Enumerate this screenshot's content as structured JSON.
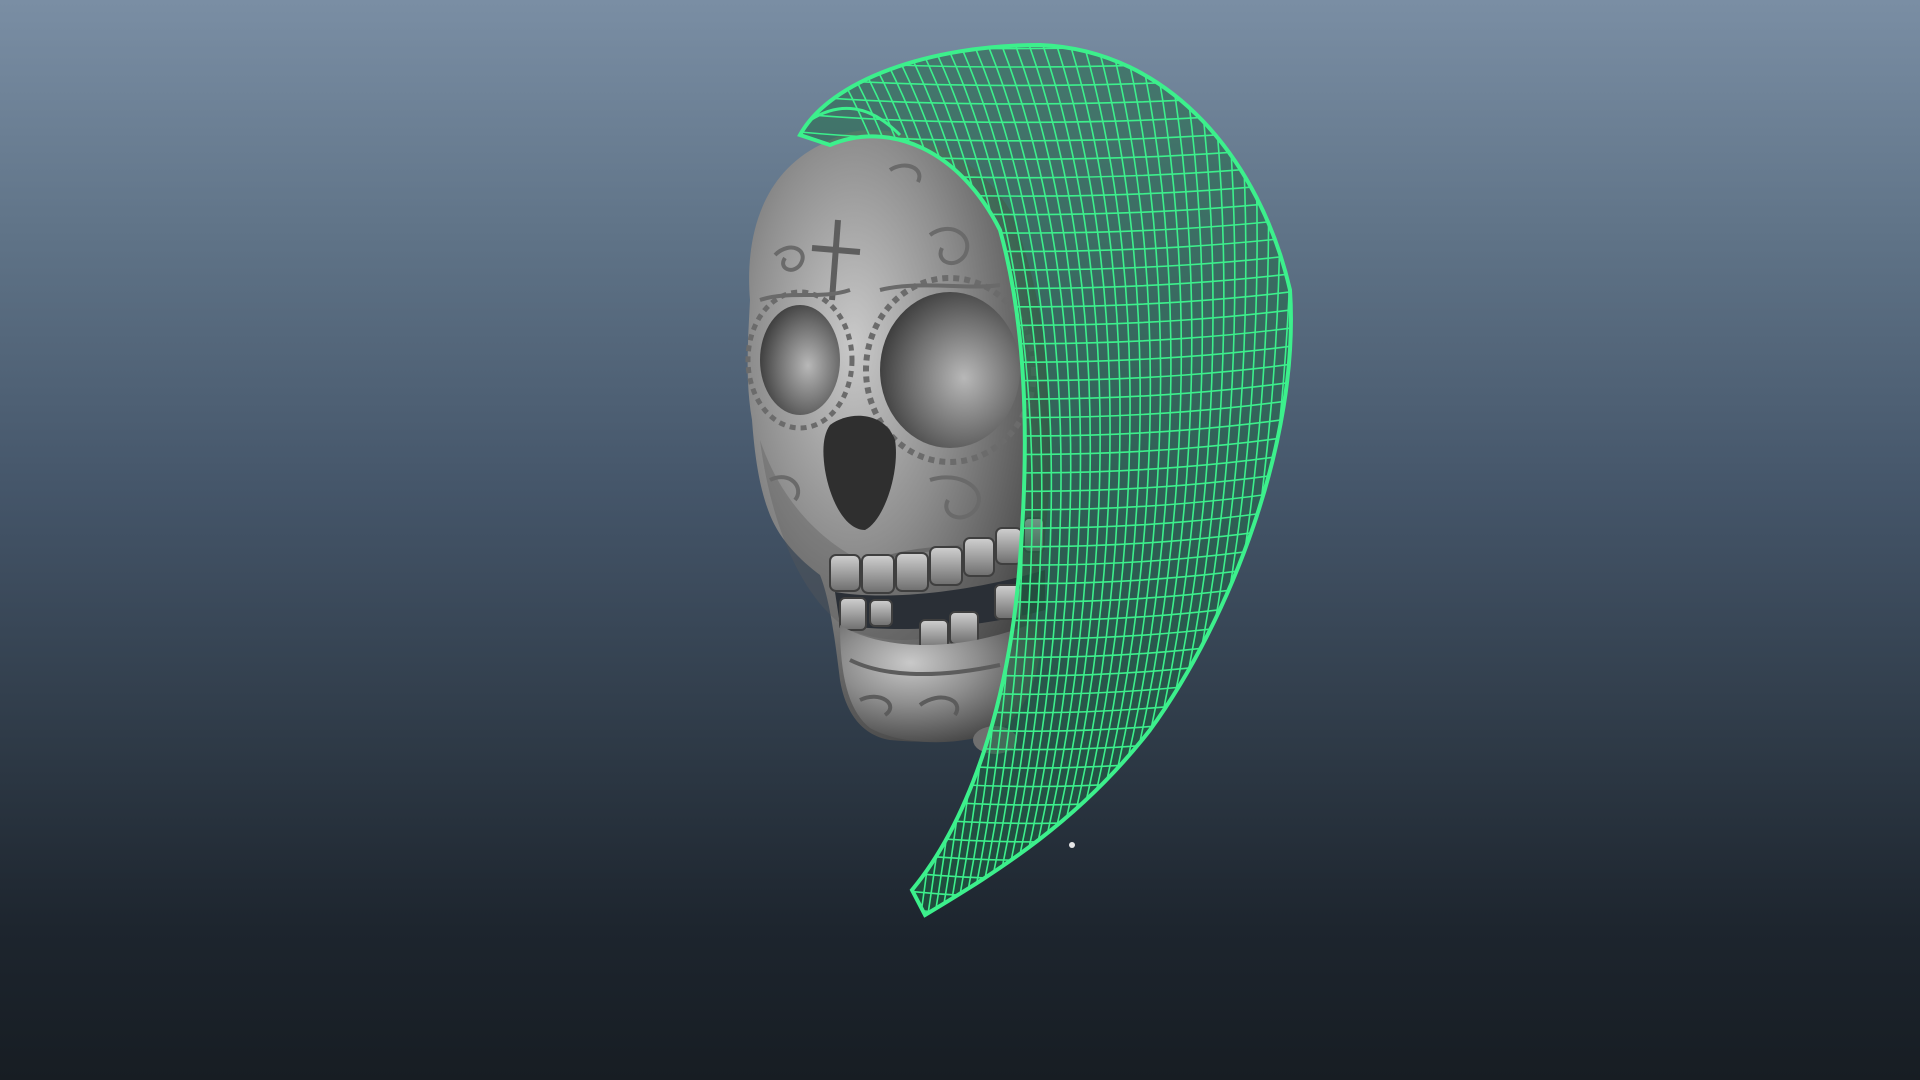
{
  "viewport": {
    "background_top": "#7a8ea4",
    "background_bottom": "#171d23"
  },
  "model": {
    "skull_color": "#8f8f8f",
    "wireframe_color": "#3cf08c",
    "wireframe_fill": "#1c5a3e",
    "icons": [
      "skull-mesh",
      "hood-wireframe-mesh"
    ]
  }
}
